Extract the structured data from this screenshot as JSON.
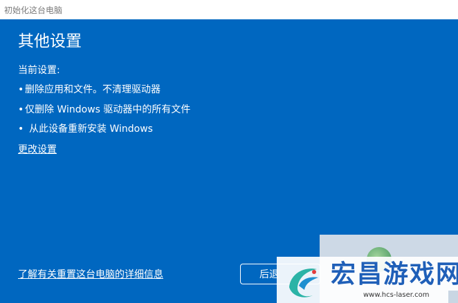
{
  "window": {
    "title": "初始化这台电脑"
  },
  "main": {
    "heading": "其他设置",
    "current_label": "当前设置:",
    "settings": [
      {
        "bullet": "•",
        "text": "删除应用和文件。不清理驱动器"
      },
      {
        "bullet": "•",
        "text": "仅删除 Windows 驱动器中的所有文件"
      },
      {
        "bullet": "•",
        "text": "从此设备重新安装 Windows"
      }
    ],
    "change_link": "更改设置"
  },
  "footer": {
    "learn_link": "了解有关重置这台电脑的详细信息",
    "back_label": "后退"
  },
  "watermark": {
    "title": "宏昌游戏网",
    "url": "www.hcs-laser.com"
  },
  "colors": {
    "background": "#0067c0",
    "titlebar": "#ffffff",
    "text": "#ffffff"
  }
}
